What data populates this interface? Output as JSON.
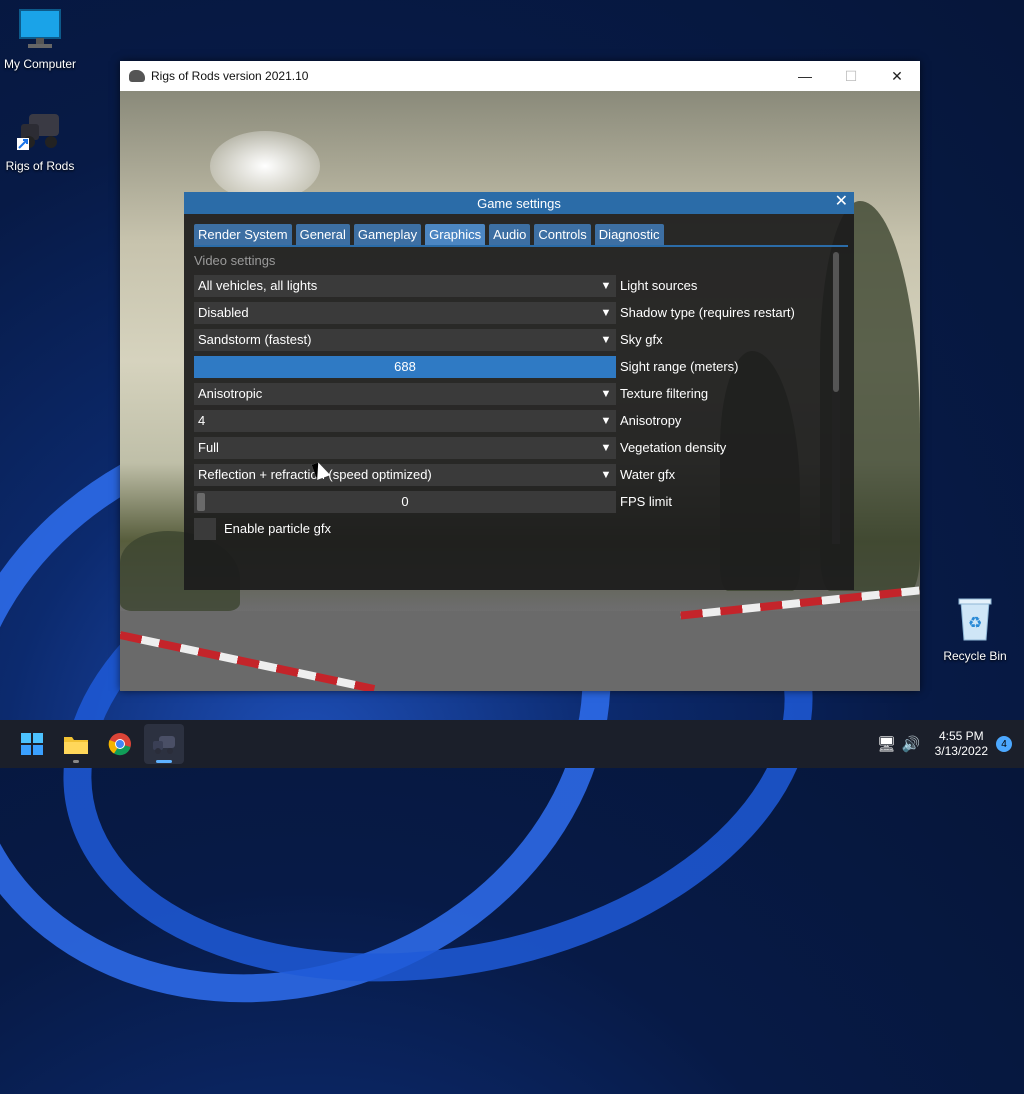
{
  "desktop": {
    "icons": [
      {
        "label": "My Computer"
      },
      {
        "label": "Rigs of Rods"
      },
      {
        "label": "Recycle Bin"
      }
    ]
  },
  "window": {
    "title": "Rigs of Rods version 2021.10",
    "minimize": "—",
    "maximize": "☐",
    "close": "✕"
  },
  "panel": {
    "title": "Game settings",
    "close": "✕",
    "tabs": [
      "Render System",
      "General",
      "Gameplay",
      "Graphics",
      "Audio",
      "Controls",
      "Diagnostic"
    ],
    "active_tab": "Graphics",
    "section_title": "Video settings",
    "rows": [
      {
        "value": "All vehicles, all lights",
        "label": "Light sources",
        "type": "dropdown"
      },
      {
        "value": "Disabled",
        "label": "Shadow type (requires restart)",
        "type": "dropdown"
      },
      {
        "value": "Sandstorm (fastest)",
        "label": "Sky gfx",
        "type": "dropdown"
      },
      {
        "value": "688",
        "label": "Sight range (meters)",
        "type": "slider"
      },
      {
        "value": "Anisotropic",
        "label": "Texture filtering",
        "type": "dropdown"
      },
      {
        "value": "4",
        "label": "Anisotropy",
        "type": "dropdown"
      },
      {
        "value": "Full",
        "label": "Vegetation density",
        "type": "dropdown"
      },
      {
        "value": "Reflection + refraction (speed optimized)",
        "label": "Water gfx",
        "type": "dropdown"
      },
      {
        "value": "0",
        "label": "FPS limit",
        "type": "slider"
      }
    ],
    "checkbox_label": "Enable particle gfx",
    "dropdown_arrow": "▼"
  },
  "taskbar": {
    "time": "4:55 PM",
    "date": "3/13/2022",
    "notification_count": "4"
  },
  "colors": {
    "accent": "#2b6ca8",
    "slider_active": "#2f7ac4",
    "panel_bg": "#1c1c1c"
  }
}
